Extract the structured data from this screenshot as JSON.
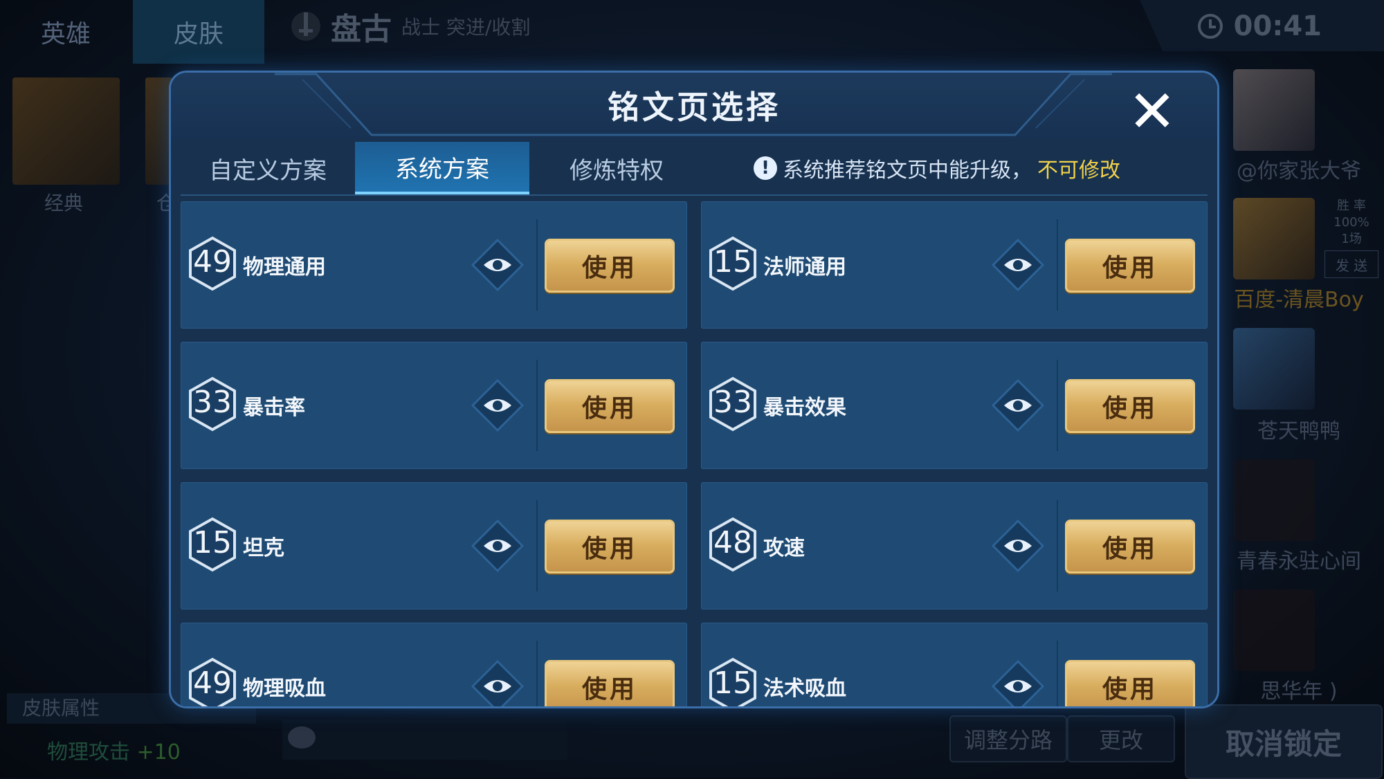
{
  "background": {
    "top_tabs": [
      "英雄",
      "皮肤"
    ],
    "hero": {
      "name": "盘古",
      "role": "战士 突进/收割"
    },
    "timer": "00:41",
    "skins": [
      {
        "label": "经典"
      },
      {
        "label": "仓"
      }
    ],
    "teammates": [
      {
        "name": "@你家张大爷"
      },
      {
        "name": "百度-清晨Boy",
        "winrate_label": "胜 率",
        "winrate": "100%",
        "matches": "1场",
        "send": "发 送"
      },
      {
        "name": "苍天鸭鸭"
      },
      {
        "name": "青春永驻心间"
      },
      {
        "name": "思华年 )"
      }
    ],
    "skin_attr": {
      "title": "皮肤属性",
      "stat": "物理攻击",
      "bonus": "+10"
    },
    "buttons": {
      "adjust_lane": "调整分路",
      "change": "更改",
      "cancel_lock": "取消锁定"
    }
  },
  "modal": {
    "title": "铭文页选择",
    "close_icon": "close-icon",
    "tabs": [
      {
        "label": "自定义方案",
        "active": false
      },
      {
        "label": "系统方案",
        "active": true
      },
      {
        "label": "修炼特权",
        "active": false
      }
    ],
    "notice": {
      "text": "系统推荐铭文页中能升级，",
      "warning": "不可修改"
    },
    "pages": [
      {
        "level": "49",
        "name": "物理通用",
        "button": "使用"
      },
      {
        "level": "15",
        "name": "法师通用",
        "button": "使用"
      },
      {
        "level": "33",
        "name": "暴击率",
        "button": "使用"
      },
      {
        "level": "33",
        "name": "暴击效果",
        "button": "使用"
      },
      {
        "level": "15",
        "name": "坦克",
        "button": "使用"
      },
      {
        "level": "48",
        "name": "攻速",
        "button": "使用"
      },
      {
        "level": "49",
        "name": "物理吸血",
        "button": "使用"
      },
      {
        "level": "15",
        "name": "法术吸血",
        "button": "使用"
      }
    ]
  },
  "colors": {
    "modal_bg": "#17314f",
    "card_bg": "#1e4a73",
    "tab_active": "#1f73b0",
    "use_button": "#d8ad5e",
    "warning_text": "#f2d24a"
  }
}
